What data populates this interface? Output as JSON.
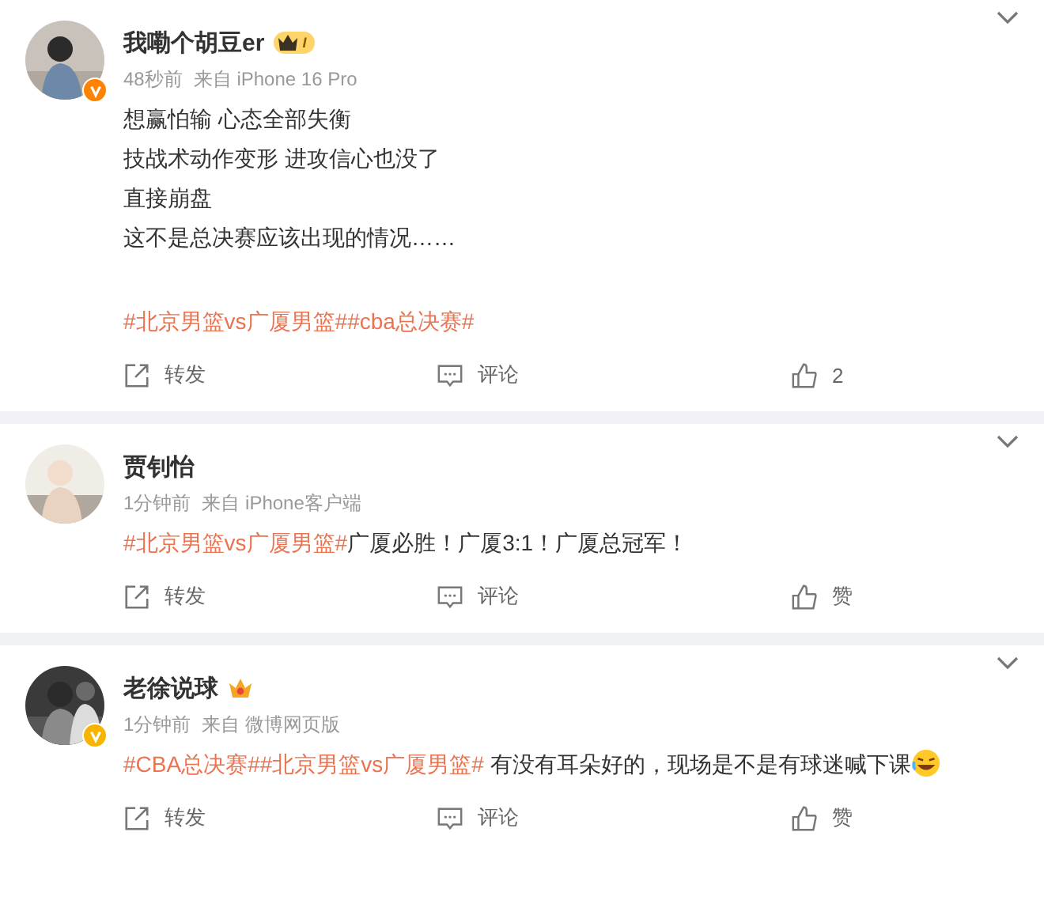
{
  "posts": [
    {
      "name": "我嘞个胡豆er",
      "badge": {
        "kind": "crown-level",
        "text": "I"
      },
      "verified": {
        "color": "#ff8200"
      },
      "time": "48秒前",
      "source": "来自 iPhone 16 Pro",
      "paragraphs": [
        [
          [
            {
              "kind": "text",
              "text": "想赢怕输 心态全部失衡"
            }
          ],
          [
            {
              "kind": "text",
              "text": "技战术动作变形 进攻信心也没了"
            }
          ],
          [
            {
              "kind": "text",
              "text": "直接崩盘"
            }
          ],
          [
            {
              "kind": "text",
              "text": "这不是总决赛应该出现的情况……"
            }
          ]
        ],
        [
          [
            {
              "kind": "tag",
              "text": "#北京男篮vs广厦男篮#"
            },
            {
              "kind": "tag",
              "text": "#cba总决赛#"
            }
          ]
        ]
      ],
      "actions": {
        "repost": "转发",
        "comment": "评论",
        "like": "2"
      }
    },
    {
      "name": "贾钊怡",
      "time": "1分钟前",
      "source": "来自 iPhone客户端",
      "paragraphs": [
        [
          [
            {
              "kind": "tag",
              "text": "#北京男篮vs广厦男篮#"
            },
            {
              "kind": "text",
              "text": "广厦必胜！广厦3:1！广厦总冠军！"
            }
          ]
        ]
      ],
      "actions": {
        "repost": "转发",
        "comment": "评论",
        "like": "赞"
      }
    },
    {
      "name": "老徐说球",
      "badge": {
        "kind": "crown"
      },
      "verified": {
        "color": "#f7b500"
      },
      "time": "1分钟前",
      "source": "来自 微博网页版",
      "paragraphs": [
        [
          [
            {
              "kind": "tag",
              "text": "#CBA总决赛#"
            },
            {
              "kind": "tag",
              "text": "#北京男篮vs广厦男篮#"
            },
            {
              "kind": "text",
              "text": " 有没有耳朵好的，现场是不是有球迷喊下课"
            },
            {
              "kind": "emoji"
            }
          ]
        ]
      ],
      "actions": {
        "repost": "转发",
        "comment": "评论",
        "like": "赞"
      }
    }
  ]
}
